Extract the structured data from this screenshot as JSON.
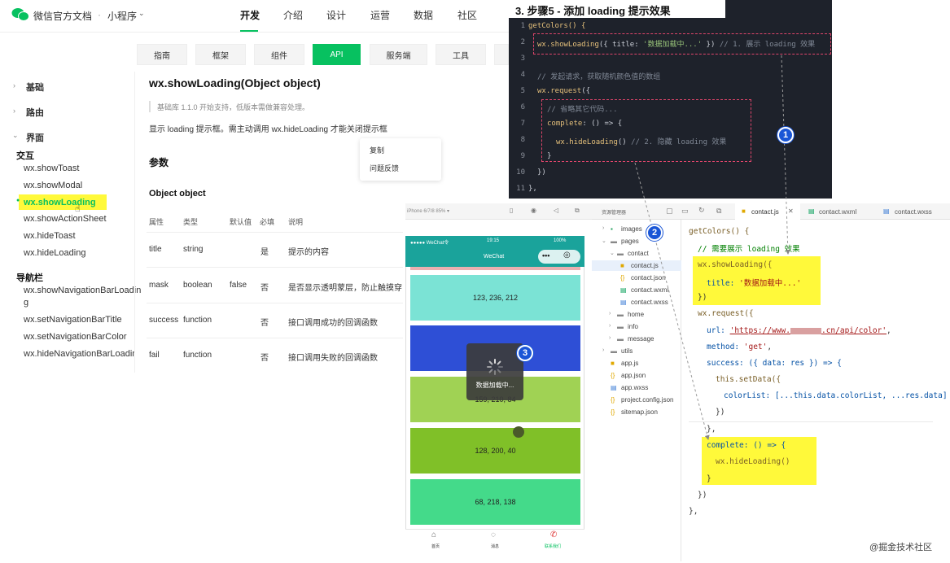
{
  "header": {
    "site_title": "微信官方文档",
    "separator": "·",
    "site_sub": "小程序",
    "nav": [
      "开发",
      "介绍",
      "设计",
      "运营",
      "数据",
      "社区"
    ]
  },
  "tabs": [
    "指南",
    "框架",
    "组件",
    "API",
    "服务端",
    "工具"
  ],
  "sidebar": {
    "sections": [
      "基础",
      "路由",
      "界面"
    ],
    "group_interact": "交互",
    "interact_items": [
      "wx.showToast",
      "wx.showModal",
      "wx.showLoading",
      "wx.showActionSheet",
      "wx.hideToast",
      "wx.hideLoading"
    ],
    "group_nav": "导航栏",
    "nav_items": [
      "wx.showNavigationBarLoadin",
      "g",
      "wx.setNavigationBarTitle",
      "wx.setNavigationBarColor",
      "wx.hideNavigationBarLoading"
    ]
  },
  "doc": {
    "title": "wx.showLoading(Object object)",
    "note": "基础库 1.1.0 开始支持，低版本需做兼容处理。",
    "desc": "显示 loading 提示框。需主动调用 wx.hideLoading 才能关闭提示框",
    "params_heading": "参数",
    "object_heading": "Object object",
    "columns": [
      "属性",
      "类型",
      "默认值",
      "必填",
      "说明"
    ],
    "rows": [
      {
        "name": "title",
        "type": "string",
        "default": "",
        "required": "是",
        "desc": "提示的内容"
      },
      {
        "name": "mask",
        "type": "boolean",
        "default": "false",
        "required": "否",
        "desc": "是否显示透明蒙层，防止触摸穿"
      },
      {
        "name": "success",
        "type": "function",
        "default": "",
        "required": "否",
        "desc": "接口调用成功的回调函数"
      },
      {
        "name": "fail",
        "type": "function",
        "default": "",
        "required": "否",
        "desc": "接口调用失败的回调函数"
      }
    ],
    "context_menu": [
      "复制",
      "问题反馈"
    ]
  },
  "code": {
    "title": "3. 步骤5 - 添加 loading 提示效果",
    "line_numbers": [
      "1",
      "2",
      "3",
      "4",
      "5",
      "6",
      "7",
      "8",
      "9",
      "10",
      "11"
    ],
    "l1": "getColors() {",
    "l2_fn": "wx.showLoading",
    "l2_a": "({ title: ",
    "l2_str": "'数据加载中...'",
    "l2_b": " }) ",
    "l2_cm": "// 1. 展示 loading 效果",
    "l4": "// 发起请求，获取随机颜色值的数组",
    "l5_fn": "wx.request",
    "l5_b": "({",
    "l6": "// 省略其它代码...",
    "l7_fn": "complete",
    "l7_b": ": () => {",
    "l8_fn": "wx.hideLoading",
    "l8_b": "() ",
    "l8_cm": "// 2. 隐藏 loading 效果",
    "l9": "}",
    "l10": "})",
    "l11": "},"
  },
  "simulator": {
    "device": "iPhone 6/7/8 85% ▾",
    "status_left": "●●●●● WeChat令",
    "status_time": "19:15",
    "status_right": "100%",
    "nav_title": "WeChat",
    "cards": [
      {
        "label": "123, 236, 212",
        "color": "#7be3d5"
      },
      {
        "label": "",
        "color": "#2e4fd6"
      },
      {
        "label": "159, 210, 84",
        "color": "#a0d254"
      },
      {
        "label": "128, 200, 40",
        "color": "#80c028"
      },
      {
        "label": "68, 218, 138",
        "color": "#44da8a"
      }
    ],
    "toast_text": "数据加载中...",
    "tab_labels": [
      "首页",
      "消息",
      "联系我们"
    ]
  },
  "devtools": {
    "title": "资源管理器",
    "tabs": [
      "contact.js",
      "contact.wxml",
      "contact.wxss"
    ],
    "tree": [
      "images",
      "pages",
      "contact",
      "contact.js",
      "contact.json",
      "contact.wxml",
      "contact.wxss",
      "home",
      "info",
      "message",
      "utils",
      "app.js",
      "app.json",
      "app.wxss",
      "project.config.json",
      "sitemap.json"
    ],
    "editor": {
      "e1": "getColors() {",
      "e2": "// 需要展示 loading 效果",
      "e3": "wx.showLoading({",
      "e4a": "title: ",
      "e4s": "'数据加载中...'",
      "e5": "})",
      "e6": "wx.request({",
      "e7a": "url: ",
      "e7s": "'https://www.",
      "e7s2": ".cn/api/color'",
      "e7b": ",",
      "e8a": "method: ",
      "e8s": "'get'",
      "e8b": ",",
      "e9": "success: ({ data: res }) => {",
      "e10": "this.setData({",
      "e11": "colorList: [...this.data.colorList, ...res.data]",
      "e12": "})",
      "e13": "},",
      "e14": "complete: () => {",
      "e15": "wx.hideLoading()",
      "e16": "}",
      "e17": "})",
      "e18": "},"
    }
  },
  "badges": [
    "1",
    "2",
    "3"
  ],
  "watermark": "@掘金技术社区"
}
